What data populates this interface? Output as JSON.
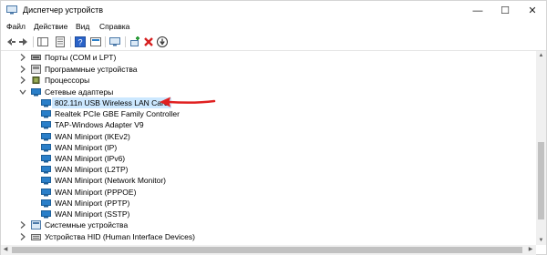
{
  "window": {
    "title": "Диспетчер устройств",
    "controls": {
      "minimize": "—",
      "maximize": "☐",
      "close": "✕"
    }
  },
  "menu": [
    "Файл",
    "Действие",
    "Вид",
    "Справка"
  ],
  "tree": {
    "categories_top": [
      {
        "label": "Порты (COM и LPT)",
        "expanded": false
      },
      {
        "label": "Программные устройства",
        "expanded": false
      },
      {
        "label": "Процессоры",
        "expanded": false
      },
      {
        "label": "Сетевые адаптеры",
        "expanded": true
      }
    ],
    "adapters": [
      {
        "label": "802.11n USB Wireless LAN Card",
        "selected": true
      },
      {
        "label": "Realtek PCIe GBE Family Controller"
      },
      {
        "label": "TAP-Windows Adapter V9"
      },
      {
        "label": "WAN Miniport (IKEv2)"
      },
      {
        "label": "WAN Miniport (IP)"
      },
      {
        "label": "WAN Miniport (IPv6)"
      },
      {
        "label": "WAN Miniport (L2TP)"
      },
      {
        "label": "WAN Miniport (Network Monitor)"
      },
      {
        "label": "WAN Miniport (PPPOE)"
      },
      {
        "label": "WAN Miniport (PPTP)"
      },
      {
        "label": "WAN Miniport (SSTP)"
      }
    ],
    "categories_bottom": [
      {
        "label": "Системные устройства",
        "expanded": false
      },
      {
        "label": "Устройства HID (Human Interface Devices)",
        "expanded": false
      }
    ]
  },
  "colors": {
    "selection": "#cce8ff",
    "annotation_arrow": "#e02020",
    "adapter_icon": "#2a7fc9",
    "toolbar_remove": "#d62020",
    "toolbar_add": "#2e9b3a"
  }
}
